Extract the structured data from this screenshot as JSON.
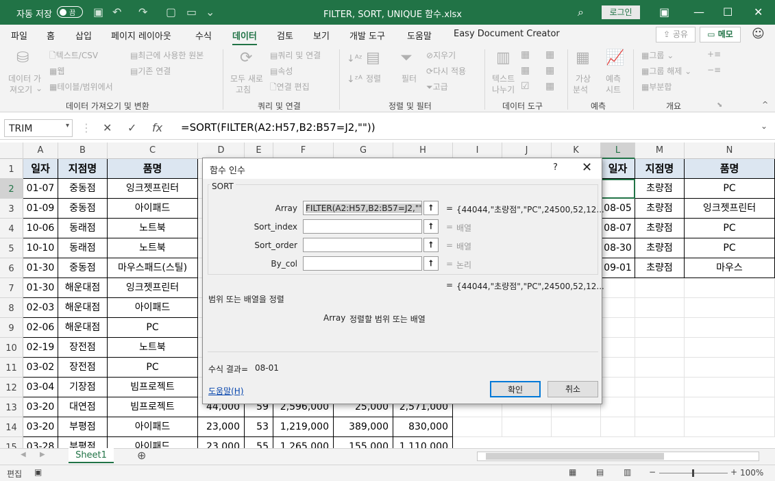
{
  "titlebar": {
    "autosave_label": "자동 저장",
    "autosave_state": "끔",
    "file_title": "FILTER, SORT, UNIQUE 함수.xlsx",
    "login_label": "로그인"
  },
  "ribbon_tabs": [
    "파일",
    "홈",
    "삽입",
    "페이지 레이아웃",
    "수식",
    "데이터",
    "검토",
    "보기",
    "개발 도구",
    "도움말",
    "Easy Document Creator"
  ],
  "active_tab": "데이터",
  "share_label": "공유",
  "memo_label": "메모",
  "ribbon": {
    "get_data": [
      "데이터 가",
      "져오기"
    ],
    "text_csv": "텍스트/CSV",
    "web": "웹",
    "table_range": "테이블/범위에서",
    "recent_sources": "최근에 사용한 원본",
    "existing_conn": "기존 연결",
    "group1_label": "데이터 가져오기 및 변환",
    "refresh_all": [
      "모두 새로",
      "고침"
    ],
    "queries_conn": "쿼리 및 연결",
    "properties": "속성",
    "edit_links": "연결 편집",
    "group2_label": "쿼리 및 연결",
    "sort": "정렬",
    "filter": "필터",
    "clear": "지우기",
    "reapply": "다시 적용",
    "advanced": "고급",
    "group3_label": "정렬 및 필터",
    "text_to_cols": [
      "텍스트",
      "나누기"
    ],
    "group4_label": "데이터 도구",
    "what_if": [
      "가상",
      "분석"
    ],
    "forecast_sheet": [
      "예측",
      "시트"
    ],
    "group5_label": "예측",
    "group_btn": "그룹",
    "ungroup_btn": "그룹 해제",
    "subtotal": "부분합",
    "group6_label": "개요"
  },
  "formula_bar": {
    "name_box": "TRIM",
    "formula": "=SORT(FILTER(A2:H57,B2:B57=J2,\"\"))"
  },
  "columns": [
    "A",
    "B",
    "C",
    "D",
    "E",
    "F",
    "G",
    "H",
    "I",
    "J",
    "K",
    "L",
    "M",
    "N"
  ],
  "selected_column": "L",
  "rows": [
    "1",
    "2",
    "3",
    "4",
    "5",
    "6",
    "7",
    "8",
    "9",
    "10",
    "11",
    "12",
    "13",
    "14",
    "15"
  ],
  "selected_row": "2",
  "table_headers": [
    "일자",
    "지점명",
    "품명"
  ],
  "table_rows": [
    [
      "01-07",
      "중동점",
      "잉크젯프린터"
    ],
    [
      "01-09",
      "중동점",
      "아이패드"
    ],
    [
      "10-06",
      "동래점",
      "노트북"
    ],
    [
      "10-10",
      "동래점",
      "노트북"
    ],
    [
      "01-30",
      "중동점",
      "마우스패드(스틸)"
    ],
    [
      "01-30",
      "해운대점",
      "잉크젯프린터"
    ],
    [
      "02-03",
      "해운대점",
      "아이패드"
    ],
    [
      "02-06",
      "해운대점",
      "PC"
    ],
    [
      "02-19",
      "장전점",
      "노트북"
    ],
    [
      "03-02",
      "장전점",
      "PC"
    ],
    [
      "03-04",
      "기장점",
      "빔프로젝트"
    ],
    [
      "03-20",
      "대연점",
      "빔프로젝트"
    ],
    [
      "03-20",
      "부평점",
      "아이패드"
    ],
    [
      "03-28",
      "부평점",
      "아이패드"
    ]
  ],
  "numeric_rows": [
    [
      "44,000",
      "59",
      "2,596,000",
      "25,000",
      "2,571,000"
    ],
    [
      "23,000",
      "53",
      "1,219,000",
      "389,000",
      "830,000"
    ],
    [
      "23,000",
      "55",
      "1,265,000",
      "155,000",
      "1,110,000"
    ]
  ],
  "right_headers": [
    "일자",
    "지점명",
    "품명"
  ],
  "right_rows": [
    [
      "",
      "초량점",
      "PC"
    ],
    [
      "08-05",
      "초량점",
      "잉크젯프린터"
    ],
    [
      "08-07",
      "초량점",
      "PC"
    ],
    [
      "08-30",
      "초량점",
      "PC"
    ],
    [
      "09-01",
      "초량점",
      "마우스"
    ]
  ],
  "sheet_tab": "Sheet1",
  "status": {
    "mode": "편집",
    "zoom": "100%"
  },
  "dialog": {
    "title": "함수 인수",
    "help_glyph": "?",
    "function_name": "SORT",
    "args": [
      {
        "label": "Array",
        "value": "FILTER(A2:H57,B2:B57=J2,\"\")",
        "result": "{44044,\"초량점\",\"PC\",24500,52,12..."
      },
      {
        "label": "Sort_index",
        "value": "",
        "result": "배열"
      },
      {
        "label": "Sort_order",
        "value": "",
        "result": "배열"
      },
      {
        "label": "By_col",
        "value": "",
        "result": "논리"
      }
    ],
    "overall_result": "{44044,\"초량점\",\"PC\",24500,52,12...",
    "description": "범위 또는 배열을 정렬",
    "arg_help_name": "Array",
    "arg_help_text": "정렬할 범위 또는 배열",
    "formula_result_label": "수식 결과=",
    "formula_result_value": "08-01",
    "help_link": "도움말(H)",
    "ok_label": "확인",
    "cancel_label": "취소"
  }
}
